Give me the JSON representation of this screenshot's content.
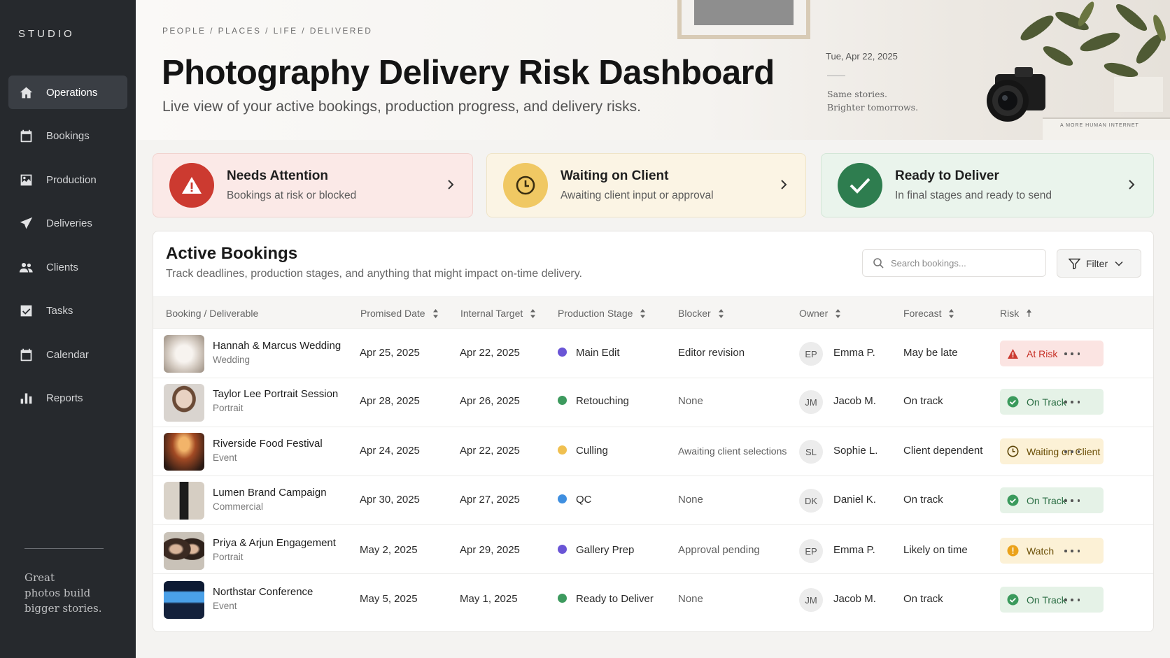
{
  "sidebar": {
    "brand": "STUDIO",
    "items": [
      {
        "label": "Operations",
        "icon": "home-icon",
        "active": true
      },
      {
        "label": "Bookings",
        "icon": "calendar-icon",
        "active": false
      },
      {
        "label": "Production",
        "icon": "image-icon",
        "active": false
      },
      {
        "label": "Deliveries",
        "icon": "send-icon",
        "active": false
      },
      {
        "label": "Clients",
        "icon": "users-icon",
        "active": false
      },
      {
        "label": "Tasks",
        "icon": "checkbox-icon",
        "active": false
      },
      {
        "label": "Calendar",
        "icon": "calendar-icon",
        "active": false
      },
      {
        "label": "Reports",
        "icon": "bar-chart-icon",
        "active": false
      }
    ],
    "quote_lines": [
      "Great",
      "photos build",
      "bigger stories."
    ]
  },
  "header": {
    "breadcrumb": "PEOPLE  /  PLACES  /  LIFE  /  DELIVERED",
    "title": "Photography Delivery Risk Dashboard",
    "subtitle": "Live view of your active bookings, production progress, and delivery risks.",
    "date": "Tue, Apr 22, 2025",
    "tagline_lines": [
      "Same stories.",
      "Brighter tomorrows."
    ],
    "book_text": "A MORE HUMAN INTERNET"
  },
  "summary": {
    "needs_attention": {
      "title": "Needs Attention",
      "subtitle": "Bookings at risk or blocked",
      "icon": "warning-icon"
    },
    "waiting": {
      "title": "Waiting on Client",
      "subtitle": "Awaiting client input or approval",
      "icon": "clock-icon"
    },
    "ready": {
      "title": "Ready to Deliver",
      "subtitle": "In final stages and ready to send",
      "icon": "checkmark-icon"
    }
  },
  "bookings": {
    "title": "Active Bookings",
    "subtitle": "Track deadlines, production stages, and anything that might impact on-time delivery.",
    "search_placeholder": "Search bookings...",
    "filter_label": "Filter",
    "columns": [
      "Booking / Deliverable",
      "Promised Date",
      "Internal Target",
      "Production Stage",
      "Blocker",
      "Owner",
      "Forecast",
      "Risk"
    ],
    "rows": [
      {
        "name": "Hannah & Marcus Wedding",
        "type": "Wedding",
        "promised": "Apr 25, 2025",
        "target": "Apr 22, 2025",
        "stage": "Main Edit",
        "stage_color": "#6a55d6",
        "blocker": "Editor revision",
        "initials": "EP",
        "owner": "Emma P.",
        "forecast": "May be late",
        "risk": "At Risk",
        "risk_level": "red"
      },
      {
        "name": "Taylor Lee Portrait Session",
        "type": "Portrait",
        "promised": "Apr 28, 2025",
        "target": "Apr 26, 2025",
        "stage": "Retouching",
        "stage_color": "#3d9a5e",
        "blocker": "None",
        "initials": "JM",
        "owner": "Jacob M.",
        "forecast": "On track",
        "risk": "On Track",
        "risk_level": "green"
      },
      {
        "name": "Riverside Food Festival",
        "type": "Event",
        "promised": "Apr 24, 2025",
        "target": "Apr 22, 2025",
        "stage": "Culling",
        "stage_color": "#f0c050",
        "blocker": "Awaiting client selections",
        "initials": "SL",
        "owner": "Sophie L.",
        "forecast": "Client dependent",
        "risk": "Waiting on Client",
        "risk_level": "yellow"
      },
      {
        "name": "Lumen Brand Campaign",
        "type": "Commercial",
        "promised": "Apr 30, 2025",
        "target": "Apr 27, 2025",
        "stage": "QC",
        "stage_color": "#3f8fe0",
        "blocker": "None",
        "initials": "DK",
        "owner": "Daniel K.",
        "forecast": "On track",
        "risk": "On Track",
        "risk_level": "green"
      },
      {
        "name": "Priya & Arjun Engagement",
        "type": "Portrait",
        "promised": "May 2, 2025",
        "target": "Apr 29, 2025",
        "stage": "Gallery Prep",
        "stage_color": "#6a55d6",
        "blocker": "Approval pending",
        "initials": "EP",
        "owner": "Emma P.",
        "forecast": "Likely on time",
        "risk": "Watch",
        "risk_level": "yellow-alert"
      },
      {
        "name": "Northstar Conference",
        "type": "Event",
        "promised": "May 5, 2025",
        "target": "May 1, 2025",
        "stage": "Ready to Deliver",
        "stage_color": "#3d9a5e",
        "blocker": "None",
        "initials": "JM",
        "owner": "Jacob M.",
        "forecast": "On track",
        "risk": "On Track",
        "risk_level": "green"
      }
    ]
  },
  "colors": {
    "sidebar_bg": "#26292d",
    "danger": "#cc3a30",
    "warning": "#f0c863",
    "success": "#2e7d4f"
  }
}
